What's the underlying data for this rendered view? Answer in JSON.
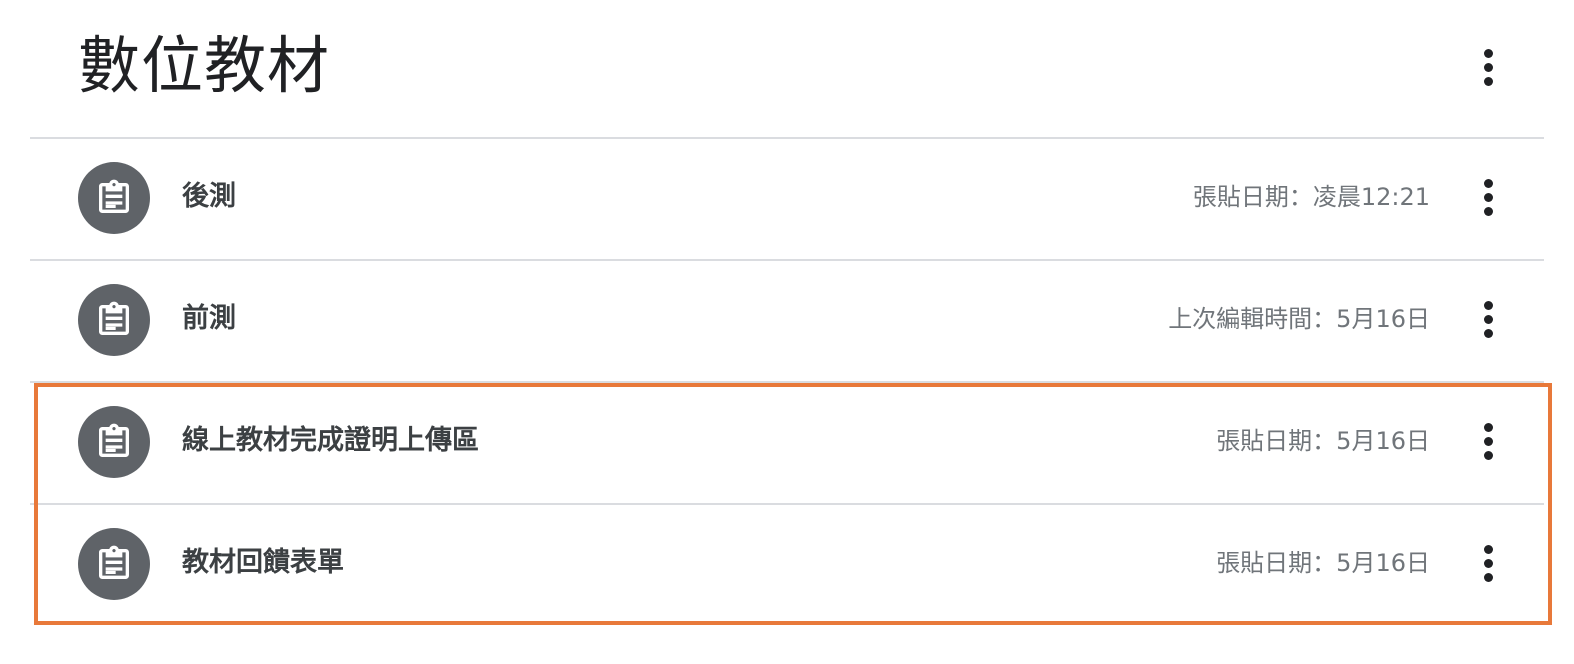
{
  "header": {
    "title": "數位教材",
    "more_icon": "more-vert-icon"
  },
  "items": [
    {
      "icon": "assignment-icon",
      "title": "後測",
      "meta": "張貼日期：凌晨12:21",
      "more_icon": "more-vert-icon"
    },
    {
      "icon": "assignment-icon",
      "title": "前測",
      "meta": "上次編輯時間：5月16日",
      "more_icon": "more-vert-icon"
    },
    {
      "icon": "assignment-icon",
      "title": "線上教材完成證明上傳區",
      "meta": "張貼日期：5月16日",
      "more_icon": "more-vert-icon"
    },
    {
      "icon": "assignment-icon",
      "title": "教材回饋表單",
      "meta": "張貼日期：5月16日",
      "more_icon": "more-vert-icon"
    }
  ],
  "colors": {
    "icon_background": "#5f6368",
    "highlight_border": "#e8793a",
    "divider": "#dadce0"
  }
}
